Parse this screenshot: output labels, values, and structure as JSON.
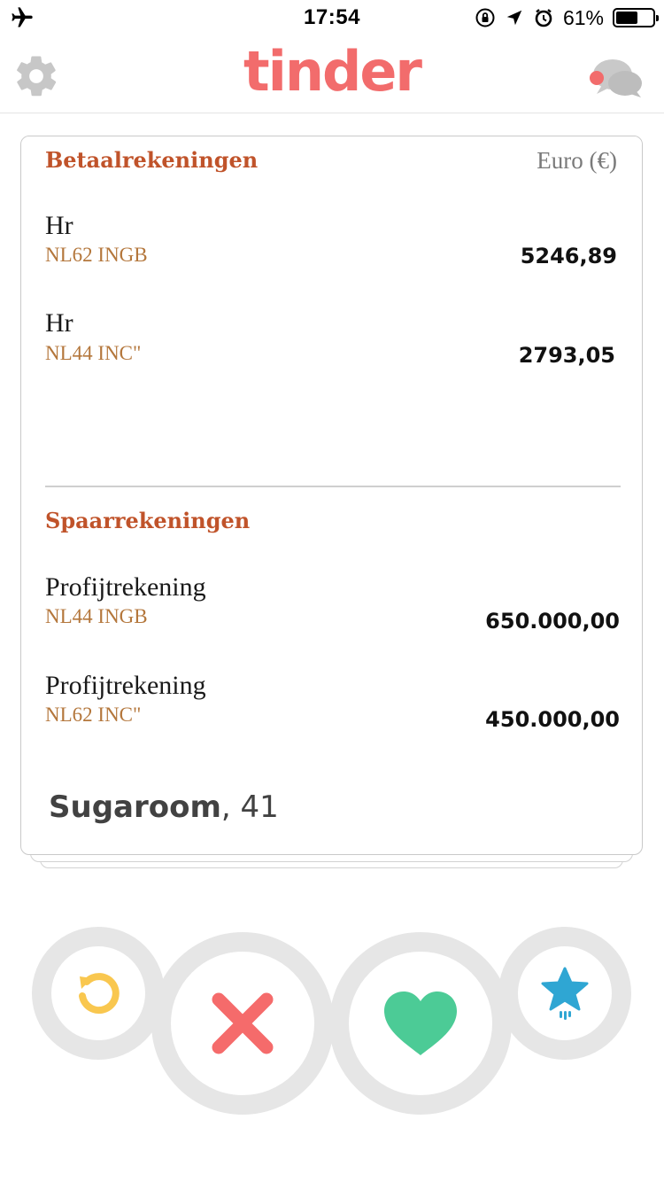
{
  "status_bar": {
    "time": "17:54",
    "battery_percent_text": "61%",
    "battery_level": 0.61,
    "icons": [
      "airplane-icon",
      "rotation-lock-icon",
      "location-arrow-icon",
      "alarm-icon",
      "battery-icon"
    ]
  },
  "nav": {
    "logo_text": "tinder",
    "brand_color": "#f26c6c",
    "left_icon": "gear-icon",
    "right_icon": "chat-bubbles-icon"
  },
  "card": {
    "photo": {
      "checking_title": "Betaalrekeningen",
      "currency_label": "Euro (€)",
      "checking_accounts": [
        {
          "name": "Hr",
          "number": "NL62 INGB",
          "amount": "5246,89"
        },
        {
          "name": "Hr",
          "number": "NL44 INC\"",
          "amount": "2793,05"
        }
      ],
      "savings_title": "Spaarrekeningen",
      "savings_accounts": [
        {
          "name": "Profijtrekening",
          "number": "NL44 INGB",
          "amount": "650.000,00"
        },
        {
          "name": "Profijtrekening",
          "number": "NL62 INC\"",
          "amount": "450.000,00"
        }
      ]
    },
    "profile": {
      "name": "Sugaroom",
      "age": "41"
    }
  },
  "actions": {
    "rewind_icon": "rewind-icon",
    "nope_icon": "close-x-icon",
    "like_icon": "heart-icon",
    "super_like_icon": "star-icon",
    "colors": {
      "rewind": "#f9c74f",
      "nope": "#f56b6b",
      "like": "#4ccb96",
      "super_like": "#2fa6d3"
    }
  }
}
